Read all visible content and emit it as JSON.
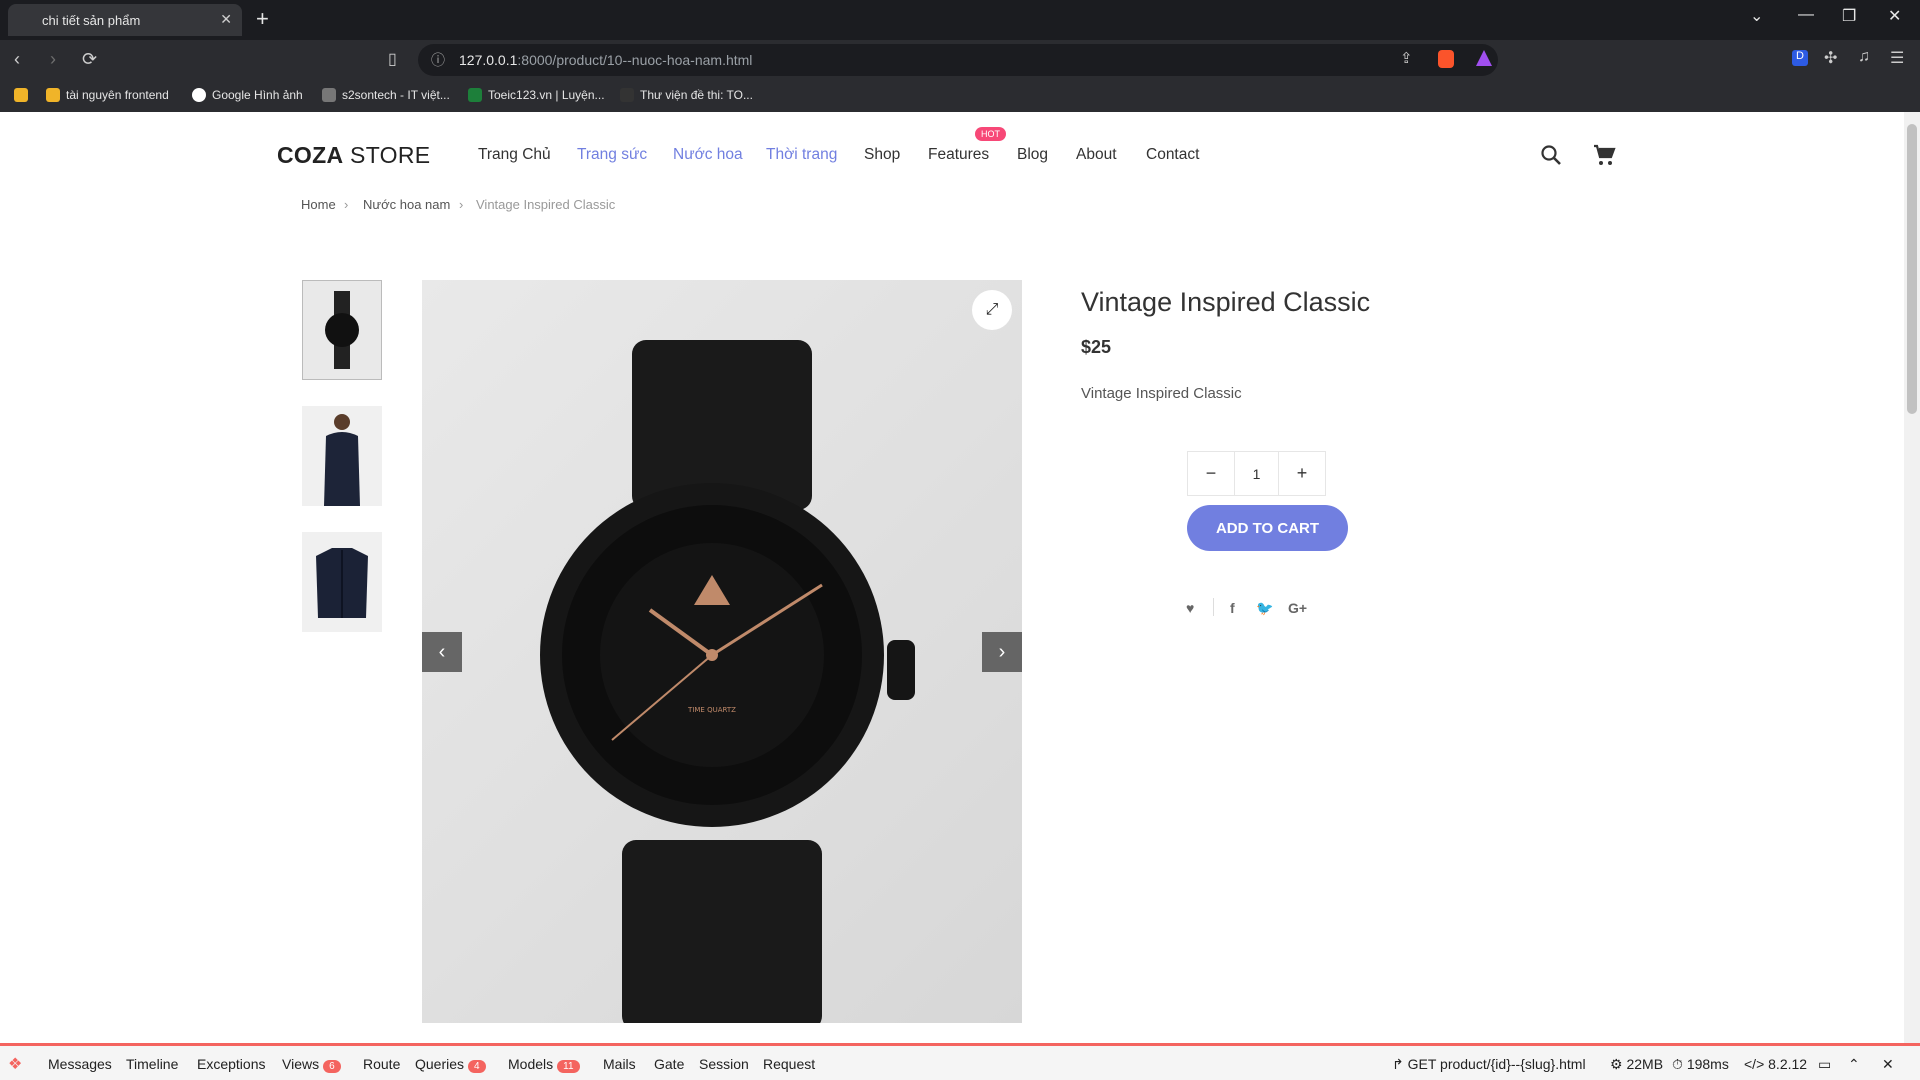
{
  "browser": {
    "tab_title": "chi tiết sản phẩm",
    "url_host": "127.0.0.1",
    "url_rest": ":8000/product/10--nuoc-hoa-nam.html",
    "bookmarks": [
      "tài nguyên frontend",
      "Google Hình ảnh",
      "s2sontech - IT việt...",
      "Toeic123.vn | Luyện...",
      "Thư viện đề thi: TO..."
    ]
  },
  "site": {
    "logo_bold": "COZA",
    "logo_rest": " STORE",
    "menu": [
      "Trang Chủ",
      "Trang sức",
      "Nước hoa",
      "Thời trang",
      "Shop",
      "Features",
      "Blog",
      "About",
      "Contact"
    ],
    "hot_badge": "HOT",
    "breadcrumb": [
      "Home",
      "Nước hoa nam",
      "Vintage Inspired Classic"
    ]
  },
  "product": {
    "title": "Vintage Inspired Classic",
    "price": "$25",
    "description": "Vintage Inspired Classic",
    "quantity": "1",
    "add_to_cart": "ADD TO CART",
    "watch_text": "TIME QUARTZ"
  },
  "debugbar": {
    "tabs": [
      "Messages",
      "Timeline",
      "Exceptions",
      "Views",
      "Route",
      "Queries",
      "Models",
      "Mails",
      "Gate",
      "Session",
      "Request"
    ],
    "views_count": "6",
    "queries_count": "4",
    "models_count": "11",
    "route": "GET product/{id}--{slug}.html",
    "memory": "22MB",
    "time": "198ms",
    "php": "8.2.12"
  }
}
